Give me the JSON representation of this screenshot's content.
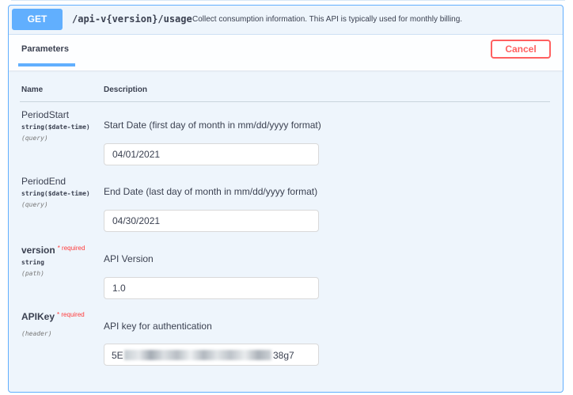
{
  "operation": {
    "method": "GET",
    "path": "/api-v{version}/usage",
    "description": "Collect consumption information. This API is typically used for monthly billing."
  },
  "section": {
    "tab_label": "Parameters",
    "cancel_label": "Cancel"
  },
  "columns": {
    "name": "Name",
    "description": "Description"
  },
  "params": [
    {
      "name": "PeriodStart",
      "required_mark": "",
      "required_text": "",
      "type": "string($date-time)",
      "in": "(query)",
      "description": "Start Date (first day of month in mm/dd/yyyy format)",
      "value": "04/01/2021"
    },
    {
      "name": "PeriodEnd",
      "required_mark": "",
      "required_text": "",
      "type": "string($date-time)",
      "in": "(query)",
      "description": "End Date (last day of month in mm/dd/yyyy format)",
      "value": "04/30/2021"
    },
    {
      "name": "version",
      "required_mark": "*",
      "required_text": "required",
      "type": "string",
      "in": "(path)",
      "description": "API Version",
      "value": "1.0"
    },
    {
      "name": "APIKey",
      "required_mark": "*",
      "required_text": "required",
      "type": "",
      "in": "(header)",
      "description": "API key for authentication",
      "value_prefix": "5E",
      "value_suffix": "38g7"
    }
  ],
  "colors": {
    "method_blue": "#61affe",
    "block_bg": "#eef5fc",
    "cancel_red": "#ff6060",
    "required_red": "#ff3a3a"
  }
}
